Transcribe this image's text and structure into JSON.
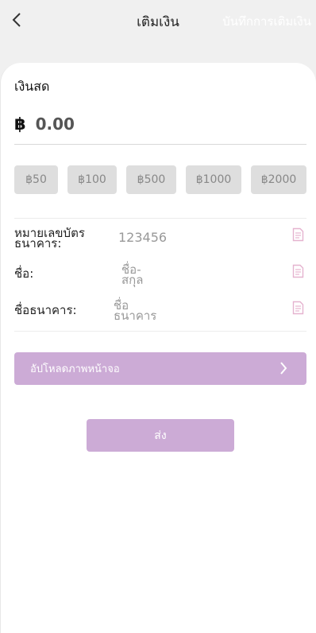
{
  "header": {
    "title": "เติมเงิน",
    "history_link": "บันทึกการเติมเงิน",
    "back_icon": "chevron-left-icon"
  },
  "cash": {
    "section_title": "เงินสด",
    "currency_symbol": "฿",
    "amount_placeholder": "0.00"
  },
  "quick_amounts": [
    "฿50",
    "฿100",
    "฿500",
    "฿1000",
    "฿2000"
  ],
  "fields": {
    "bank_account": {
      "label_line1": "หมายเลขบัตร",
      "label_line2": "ธนาคาร:",
      "value": "123456"
    },
    "name": {
      "label": "ชื่อ:",
      "value_line1": "ชื่อ-",
      "value_line2": "สกุล"
    },
    "bank_name": {
      "label": "ชื่อธนาคาร:",
      "value_line1": "ชื่อ",
      "value_line2": "ธนาคาร"
    }
  },
  "upload": {
    "label": "อัปโหลดภาพหน้าจอ"
  },
  "submit": {
    "label": "ส่ง"
  },
  "colors": {
    "accent": "#ccabd6",
    "chip_bg": "#dedede",
    "page_bg": "#f0f0f0",
    "icon_pink": "#e5b3cf"
  }
}
